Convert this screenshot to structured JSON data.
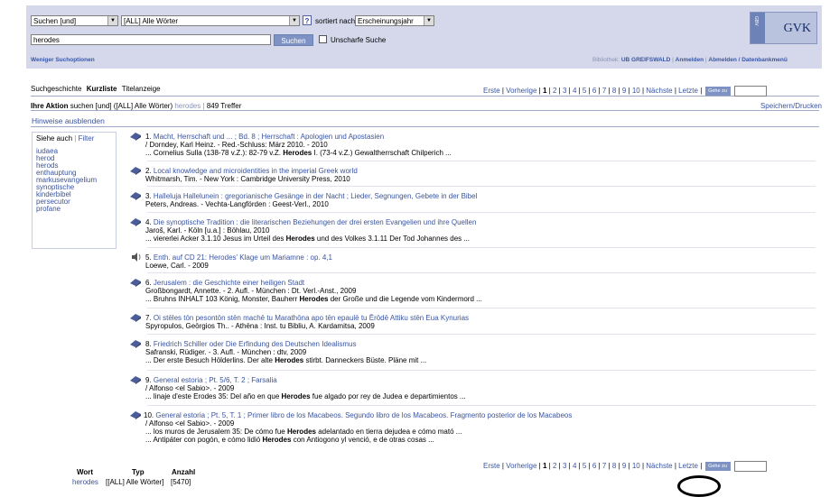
{
  "search": {
    "field_select": "Suchen [und]",
    "index_select": "[ALL] Alle Wörter",
    "help_icon": "?",
    "sorted_by_label": "sortiert nach",
    "sort_select": "Erscheinungsjahr",
    "query": "herodes",
    "search_button": "Suchen",
    "fuzzy_label": "Unscharfe Suche",
    "fewer_options": "Weniger Suchoptionen"
  },
  "topbar": {
    "library_label": "Bibliothek:",
    "library_name": "UB GREIFSWALD",
    "login": "Anmelden",
    "logout": "Abmelden / Datenbankmenü",
    "logo_text": "GVK",
    "logo_vertical": "GBV"
  },
  "tabs": [
    {
      "label": "Suchgeschichte"
    },
    {
      "label": "Kurzliste"
    },
    {
      "label": "Titelanzeige"
    }
  ],
  "pager": {
    "first": "Erste",
    "prev": "Vorherige",
    "pages": [
      "1",
      "2",
      "3",
      "4",
      "5",
      "6",
      "7",
      "8",
      "9",
      "10"
    ],
    "next": "Nächste",
    "last": "Letzte",
    "goto": "Gehe zu"
  },
  "action": {
    "label": "Ihre Aktion",
    "text": "suchen [und] ([ALL] Alle Wörter)",
    "term": "herodes",
    "hits": "849 Treffer",
    "save_print": "Speichern/Drucken",
    "hide_hints": "Hinweise ausblenden"
  },
  "sidebar": {
    "see_also": "Siehe auch",
    "filter": "Filter",
    "items": [
      "iudaea",
      "herod",
      "herods",
      "enthauptung",
      "markusevangelium",
      "synoptische",
      "kinderbibel",
      "persecutor",
      "profane"
    ]
  },
  "results": [
    {
      "num": "1.",
      "title": "Macht, Herrschaft und ... ; Bd. 8 ; Herrschaft : Apologien und Apostasien",
      "line2": "/ Dorndey, Karl Heinz. - Red.-Schluss: März 2010. - 2010",
      "snip_pre": "... Cornelius Sulla (138-78 v.Z.): 82-79 v.Z.",
      "snip_bold": "Herodes",
      "snip_post": "I. (73-4 v.Z.) Gewaltherrschaft Chilperich ...",
      "icon": "book"
    },
    {
      "num": "2.",
      "title": "Local knowledge and microidentities in the imperial Greek world",
      "line2": "Whitmarsh, Tim. - New York : Cambridge University Press, 2010",
      "icon": "book"
    },
    {
      "num": "3.",
      "title": "Halleluja Hallelunein : gregorianische Gesänge in der Nacht ; Lieder, Segnungen, Gebete in der Bibel",
      "line2": "Peters, Andreas. - Vechta-Langförden : Geest-Verl., 2010",
      "icon": "book"
    },
    {
      "num": "4.",
      "title": "Die synoptische Tradition : die literarischen Beziehungen der drei ersten Evangelien und ihre Quellen",
      "line2": "Jaroš, Karl. - Köln [u.a.] : Böhlau, 2010",
      "snip_pre": "... viererlei Acker 3.1.10 Jesus im Urteil des",
      "snip_bold": "Herodes",
      "snip_post": "und des Volkes 3.1.11 Der Tod Johannes des ...",
      "icon": "book"
    },
    {
      "num": "5.",
      "title": "Enth. auf CD 21: Herodes' Klage um Mariamne : op. 4,1",
      "line2": "Loewe, Carl. - 2009",
      "icon": "speaker"
    },
    {
      "num": "6.",
      "title": "Jerusalem : die Geschichte einer heiligen Stadt",
      "line2": "Großbongardt, Annette. - 2. Aufl. - München : Dt. Verl.-Anst., 2009",
      "snip_pre": "... Bruhns INHALT 103 König, Monster, Bauherr",
      "snip_bold": "Herodes",
      "snip_post": "der Große und die Legende vom Kindermord ...",
      "icon": "book"
    },
    {
      "num": "7.",
      "title": "Oi stēles tōn pesontōn stēn machē tu Marathōna apo tēn epaulē tu Ērōdē Attiku stēn Eua Kynurias",
      "line2": "Spyropulos, Geōrgios Th.. - Athēna : Inst. tu Bibliu, A. Kardamitsa, 2009",
      "icon": "book"
    },
    {
      "num": "8.",
      "title": "Friedrich Schiller oder Die Erfindung des Deutschen Idealismus",
      "line2": "Safranski, Rüdiger. - 3. Aufl. - München : dtv, 2009",
      "snip_pre": "... Der erste Besuch Hölderlins. Der alte",
      "snip_bold": "Herodes",
      "snip_post": "stirbt. Danneckers Büste. Pläne mit ...",
      "icon": "book"
    },
    {
      "num": "9.",
      "title": "General estoria ; Pt. 5/6, T. 2 ; Farsalia",
      "line2": "/ Alfonso <el Sabio>. - 2009",
      "snip_pre": "... linaje d'este Erodes 35: Del año en que",
      "snip_bold": "Herodes",
      "snip_post": "fue algado por rey de Judea e departimientos ...",
      "icon": "book"
    },
    {
      "num": "10.",
      "title": "General estoria ; Pt. 5, T. 1 ; Primer libro de los Macabeos. Segundo libro de los Macabeos. Fragmento posterior de los Macabeos",
      "line2": "/ Alfonso <el Sabio>. - 2009",
      "snip_pre": "... los muros de Jerusalem 35: De cómo fue",
      "snip_bold": "Herodes",
      "snip_post": "adelantado en tierra dejudea e cómo mató ...",
      "snip2_pre": "... Antipáter con pogón, e cómo lidió",
      "snip2_bold": "Herodes",
      "snip2_post": "con Antiogono yl venció, e de otras cosas ...",
      "icon": "book"
    }
  ],
  "stats": {
    "col_word": "Wort",
    "col_type": "Typ",
    "col_count": "Anzahl",
    "word": "herodes",
    "type": "[[ALL] Alle Wörter]",
    "count": "[5470]"
  }
}
